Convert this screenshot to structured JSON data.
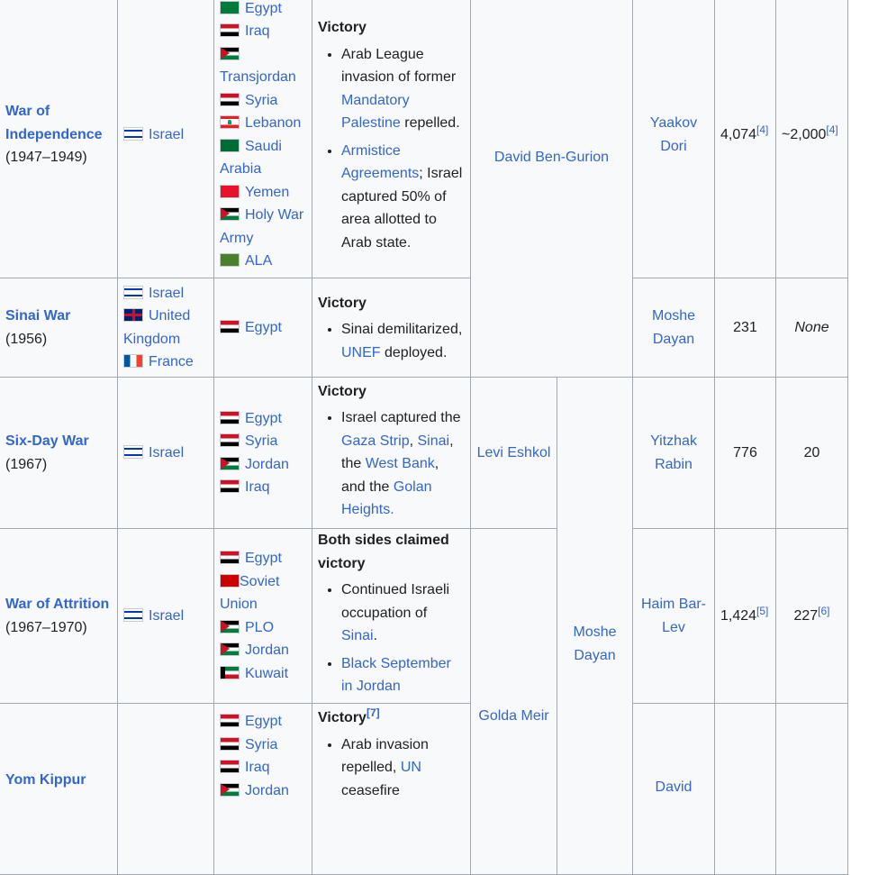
{
  "rows": [
    {
      "war": {
        "name": "War of Independence",
        "years": "(1947–1949)"
      },
      "combatants_a": [
        "Israel"
      ],
      "combatants_b": [
        "Egypt",
        "Iraq",
        "Transjordan",
        "Syria",
        "Lebanon",
        "Saudi Arabia",
        "Yemen",
        "Holy War Army",
        "ALA"
      ],
      "result": {
        "title": "Victory",
        "bullet1": [
          "Arab League invasion of former ",
          "Mandatory Palestine",
          " repelled."
        ],
        "bullet2": [
          "Armistice Agreements",
          "; Israel captured 50% of area allotted to Arab state."
        ]
      },
      "pm": "David Ben-Gurion",
      "defense_min": "",
      "chief_of_staff": "Yaakov Dori",
      "israeli_killed": "4,074",
      "israeli_killed_ref": "[4]",
      "israeli_captured": "~2,000",
      "israeli_captured_ref": "[4]"
    },
    {
      "war": {
        "name": "Sinai War",
        "years": "(1956)"
      },
      "combatants_a": [
        "Israel",
        "United Kingdom",
        "France"
      ],
      "combatants_b": [
        "Egypt"
      ],
      "result": {
        "title": "Victory",
        "bullet1": [
          "Sinai demilitarized, ",
          "UNEF",
          " deployed."
        ]
      },
      "chief_of_staff": "Moshe Dayan",
      "israeli_killed": "231",
      "israeli_captured": "None"
    },
    {
      "war": {
        "name": "Six-Day War",
        "years": "(1967)"
      },
      "combatants_a": [
        "Israel"
      ],
      "combatants_b": [
        "Egypt",
        "Syria",
        "Jordan",
        "Iraq"
      ],
      "result": {
        "title": "Victory",
        "bullet1": [
          "Israel captured the ",
          "Gaza Strip",
          ", ",
          "Sinai",
          ", the ",
          "West Bank",
          ", and the ",
          "Golan Heights."
        ]
      },
      "pm": "Levi Eshkol",
      "defense_min": "Moshe Dayan",
      "chief_of_staff": "Yitzhak Rabin",
      "israeli_killed": "776",
      "israeli_captured": "20"
    },
    {
      "war": {
        "name": "War of Attrition",
        "years": "(1967–1970)"
      },
      "combatants_a": [
        "Israel"
      ],
      "combatants_b": [
        "Egypt",
        "Soviet Union",
        "PLO",
        "Jordan",
        "Kuwait"
      ],
      "result": {
        "title": "Both sides claimed victory",
        "bullet1": [
          "Continued Israeli occupation of ",
          "Sinai",
          "."
        ],
        "bullet2": [
          "Black September in Jordan"
        ]
      },
      "pm": "Golda Meir",
      "chief_of_staff": "Haim Bar-Lev",
      "israeli_killed": "1,424",
      "israeli_killed_ref": "[5]",
      "israeli_captured": "227",
      "israeli_captured_ref": "[6]"
    },
    {
      "war": {
        "name": "Yom Kippur",
        "years": ""
      },
      "combatants_b": [
        "Egypt",
        "Syria",
        "Iraq",
        "Jordan"
      ],
      "result": {
        "title": "Victory",
        "title_ref": "[7]",
        "bullet1": [
          "Arab invasion repelled, ",
          "UN",
          " ceasefire"
        ]
      },
      "chief_of_staff": "David"
    }
  ]
}
